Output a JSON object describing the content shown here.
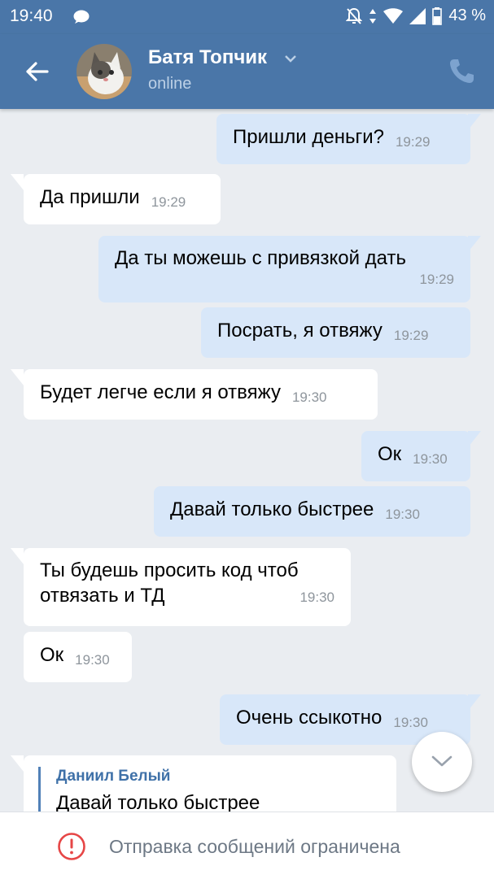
{
  "statusbar": {
    "time": "19:40",
    "battery": "43 %"
  },
  "header": {
    "name": "Батя Топчик",
    "status": "online"
  },
  "messages": [
    {
      "dir": "out",
      "text": "Пришли деньги?",
      "time": "19:29"
    },
    {
      "dir": "in",
      "text": "Да пришли",
      "time": "19:29"
    },
    {
      "dir": "out",
      "text": "Да ты можешь с привязкой дать",
      "time": "19:29"
    },
    {
      "dir": "out",
      "text": "Посрать, я отвяжу",
      "time": "19:29"
    },
    {
      "dir": "in",
      "text": "Будет легче если я отвяжу",
      "time": "19:30"
    },
    {
      "dir": "out",
      "text": "Ок",
      "time": "19:30"
    },
    {
      "dir": "out",
      "text": "Давай только быстрее",
      "time": "19:30"
    },
    {
      "dir": "in",
      "text_line1": "Ты будешь просить код чтоб",
      "text_line2": "отвязать и ТД",
      "time": "19:30"
    },
    {
      "dir": "in",
      "text": "Ок",
      "time": "19:30"
    },
    {
      "dir": "out",
      "text": "Очень ссыкотно",
      "time": "19:30"
    },
    {
      "dir": "in",
      "reply_author": "Даниил Белый",
      "reply_text": "Давай только быстрее"
    }
  ],
  "footer": {
    "notice": "Отправка сообщений ограничена"
  },
  "icons": {
    "back": "arrow-left-icon",
    "phone": "phone-icon",
    "chevron": "chevron-down-icon",
    "scroll": "scroll-down-icon",
    "warning": "alert-circle-icon"
  },
  "colors": {
    "brand": "#4a76a8",
    "outgoing": "#d8e7f9",
    "incoming": "#ffffff",
    "warning": "#e64646"
  }
}
